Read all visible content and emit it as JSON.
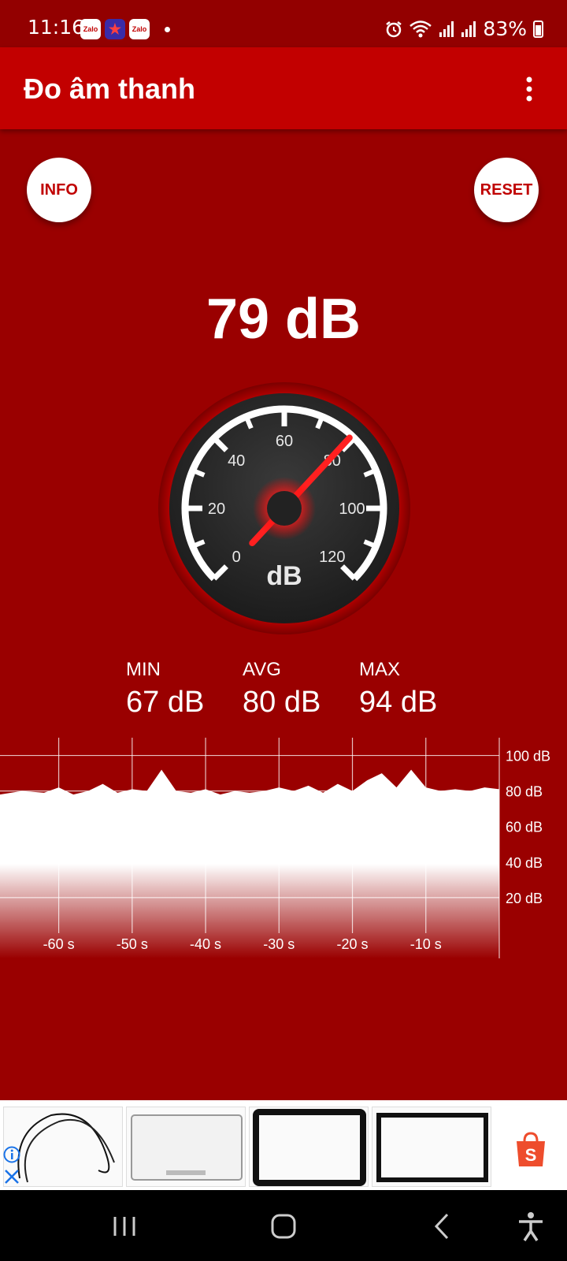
{
  "status_bar": {
    "time": "11:16",
    "notifications": [
      {
        "label": "Zalo",
        "icon": "zalo-icon"
      },
      {
        "label": "",
        "icon": "star-app-icon"
      },
      {
        "label": "Zalo",
        "icon": "zalo-icon"
      }
    ],
    "battery": "83%",
    "icons": [
      "alarm-icon",
      "wifi-icon",
      "signal-icon",
      "signal-icon",
      "battery-icon"
    ]
  },
  "app_bar": {
    "title": "Đo âm thanh",
    "menu_icon": "more-vertical-icon"
  },
  "buttons": {
    "info": "INFO",
    "reset": "RESET"
  },
  "reading": {
    "current": "79 dB",
    "needle_value": 79
  },
  "gauge": {
    "unit": "dB",
    "min": 0,
    "max": 120,
    "labels": [
      "0",
      "20",
      "40",
      "60",
      "80",
      "100",
      "120"
    ]
  },
  "stats": {
    "min_label": "MIN",
    "min_value": "67 dB",
    "avg_label": "AVG",
    "avg_value": "80 dB",
    "max_label": "MAX",
    "max_value": "94 dB"
  },
  "chart_data": {
    "type": "area",
    "x_ticks": [
      "-60 s",
      "-50 s",
      "-40 s",
      "-30 s",
      "-20 s",
      "-10 s"
    ],
    "y_ticks": [
      "100 dB",
      "80 dB",
      "60 dB",
      "40 dB",
      "20 dB"
    ],
    "ylim": [
      0,
      110
    ],
    "xlim": [
      -68,
      0
    ],
    "grid": true,
    "series": [
      {
        "x": [
          -68,
          -65,
          -62,
          -60,
          -58,
          -56,
          -54,
          -52,
          -50,
          -48,
          -46,
          -44,
          -42,
          -40,
          -38,
          -36,
          -34,
          -32,
          -30,
          -28,
          -26,
          -24,
          -22,
          -20,
          -18,
          -16,
          -14,
          -12,
          -10,
          -8,
          -6,
          -4,
          -2,
          0
        ],
        "values": [
          78,
          80,
          79,
          82,
          78,
          80,
          84,
          79,
          81,
          80,
          92,
          80,
          79,
          81,
          78,
          80,
          79,
          80,
          82,
          80,
          83,
          79,
          84,
          80,
          86,
          90,
          82,
          92,
          82,
          80,
          81,
          80,
          82,
          81
        ]
      }
    ]
  },
  "ad": {
    "thumbnails": [
      "cable-product-image",
      "laptop-screen-product-image",
      "laptop-bezel-product-image",
      "laptop-bezel-product-image"
    ],
    "brand_icon": "shopping-bag-icon"
  },
  "nav_bar": {
    "icons": [
      "recent-apps-icon",
      "home-icon",
      "back-icon",
      "accessibility-icon"
    ]
  }
}
